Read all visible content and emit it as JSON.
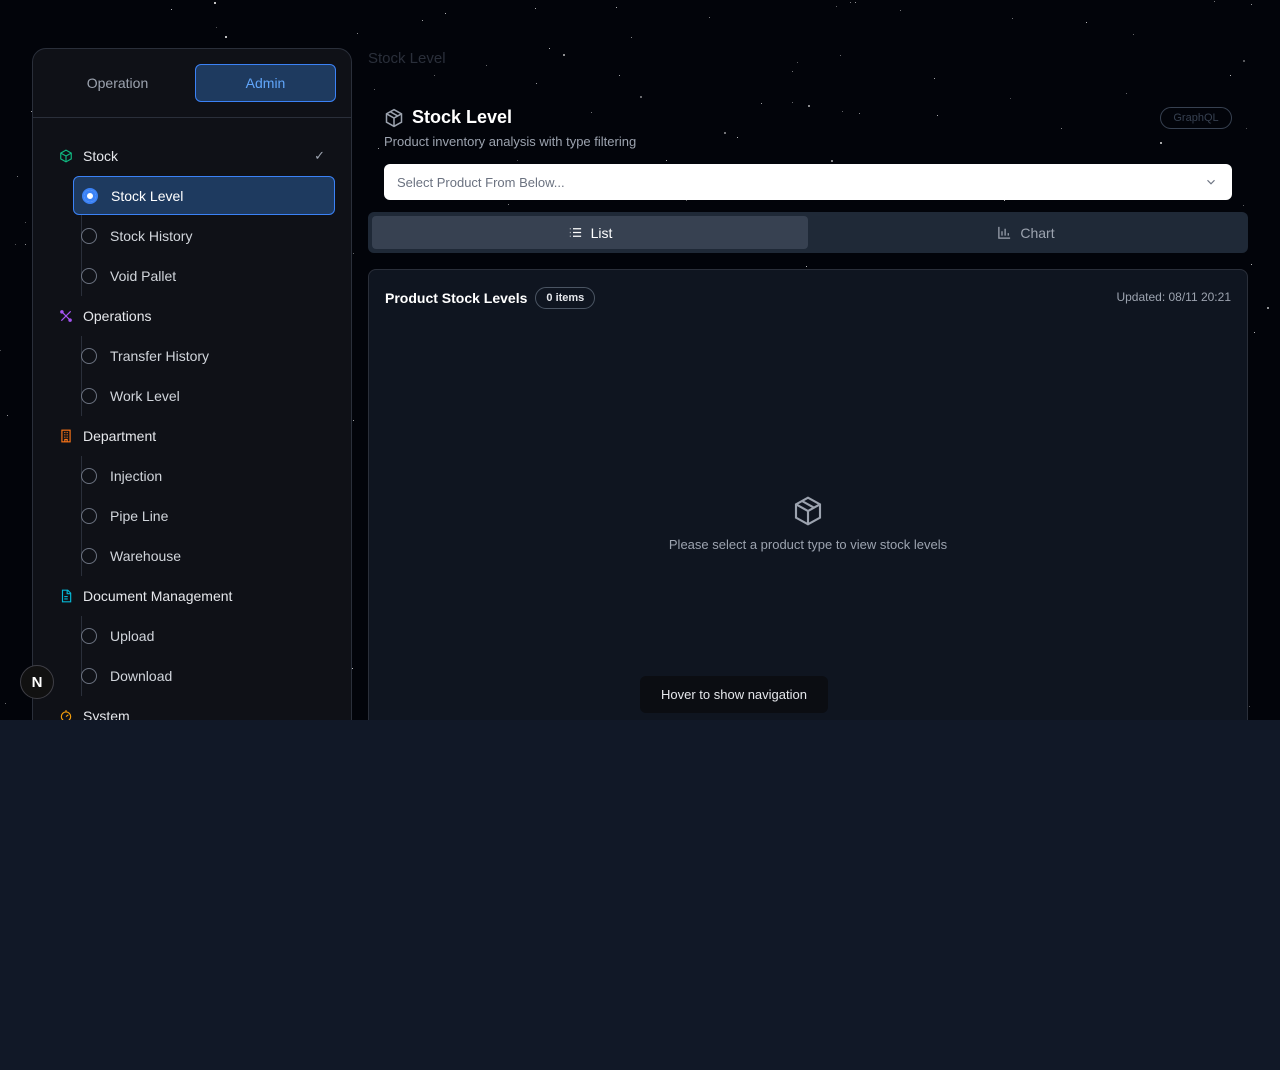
{
  "colors": {
    "accent": "#3b82f6",
    "stock_icon": "#10b981",
    "operations_icon": "#a855f7",
    "department_icon": "#f97316",
    "document_icon": "#06b6d4",
    "system_icon": "#f59e0b"
  },
  "sidebar": {
    "mode_tabs": [
      "Operation",
      "Admin"
    ],
    "active_mode": "Admin",
    "groups": [
      {
        "label": "Stock",
        "icon": "cube-icon",
        "check": "✓",
        "items": [
          {
            "label": "Stock Level",
            "active": true
          },
          {
            "label": "Stock History"
          },
          {
            "label": "Void Pallet"
          }
        ]
      },
      {
        "label": "Operations",
        "icon": "tools-icon",
        "items": [
          {
            "label": "Transfer History"
          },
          {
            "label": "Work Level"
          }
        ]
      },
      {
        "label": "Department",
        "icon": "building-icon",
        "items": [
          {
            "label": "Injection"
          },
          {
            "label": "Pipe Line"
          },
          {
            "label": "Warehouse"
          }
        ]
      },
      {
        "label": "Document Management",
        "icon": "document-icon",
        "items": [
          {
            "label": "Upload"
          },
          {
            "label": "Download"
          }
        ]
      },
      {
        "label": "System",
        "icon": "system-icon",
        "items": []
      }
    ]
  },
  "header": {
    "breadcrumb": "Stock Level",
    "title": "Stock Level",
    "subtitle": "Product inventory analysis with type filtering",
    "badge": "GraphQL"
  },
  "select": {
    "placeholder": "Select Product From Below..."
  },
  "view_tabs": {
    "list": "List",
    "chart": "Chart",
    "active": "List"
  },
  "panel": {
    "title": "Product Stock Levels",
    "items_badge": "0 items",
    "updated": "Updated: 08/11 20:21",
    "empty_text": "Please select a product type to view stock levels"
  },
  "hover_tip": "Hover to show navigation",
  "floating_button": "N"
}
